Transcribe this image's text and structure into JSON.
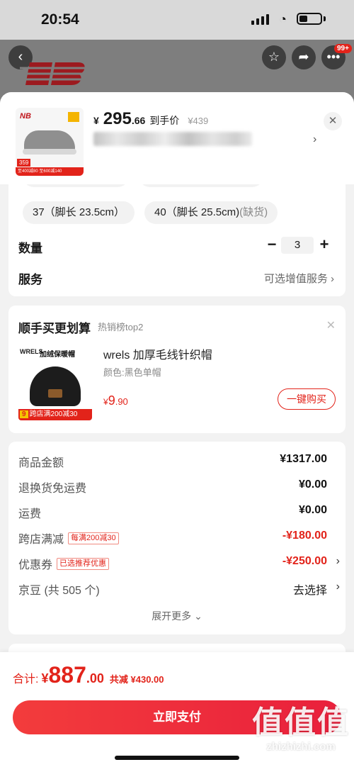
{
  "status_bar": {
    "time": "20:54"
  },
  "nav": {
    "back_icon": "‹",
    "more_badge": "99+"
  },
  "product": {
    "thumb_logo": "NB",
    "thumb_price": "359",
    "thumb_promo": "至400减80 至600减140",
    "price_yen": "¥",
    "price_int": "295",
    "price_dec": ".66",
    "price_label": "到手价",
    "price_original": "¥439",
    "spec_arrow": "›",
    "close_icon": "✕"
  },
  "sizes": {
    "row1": [
      {
        "size": "",
        "note": ""
      },
      {
        "size": "",
        "note": ""
      }
    ],
    "row2": [
      {
        "size": "37（脚长 23.5cm）",
        "note": ""
      },
      {
        "size": "40（脚长 25.5cm)",
        "note": "(缺货)"
      }
    ]
  },
  "quantity": {
    "label": "数量",
    "minus": "−",
    "value": "3",
    "plus": "+"
  },
  "service": {
    "label": "服务",
    "value": "可选增值服务  ›"
  },
  "addon": {
    "title": "顺手买更划算",
    "subtitle": "热销榜top2",
    "close_icon": "✕",
    "thumb_brand": "WRELS",
    "thumb_title": "加绒保暖帽",
    "thumb_price": "9",
    "thumb_promo": "跨店满200减30",
    "name": "wrels 加厚毛线针织帽",
    "variant": "颜色:黑色单帽",
    "price_yen": "¥",
    "price_int": "9",
    "price_dec": ".90",
    "buy_label": "一键购买"
  },
  "summary": {
    "rows": [
      {
        "label": "商品金额",
        "tag": "",
        "value": "¥1317.00",
        "arrow": ""
      },
      {
        "label": "退换货免运费",
        "tag": "",
        "value": "¥0.00",
        "arrow": ""
      },
      {
        "label": "运费",
        "tag": "",
        "value": "¥0.00",
        "arrow": ""
      },
      {
        "label": "跨店满减",
        "tag": "每满200减30",
        "value": "-¥180.00",
        "arrow": ""
      },
      {
        "label": "优惠券",
        "tag": "已选推荐优惠",
        "value": "-¥250.00",
        "arrow": "›"
      },
      {
        "label": "京豆 (共 505 个)",
        "tag": "",
        "value": "去选择",
        "arrow": "›"
      }
    ],
    "expand_label": "展开更多 ⌄"
  },
  "footer": {
    "total_label": "合计:",
    "total_yen": "¥",
    "total_int": "887",
    "total_dec": ".00",
    "total_saving": "共减 ¥430.00",
    "pay_label": "立即支付"
  },
  "watermark": {
    "big": "值值值",
    "small": "zhizhizhi.com"
  },
  "colors": {
    "accent": "#e2231a",
    "brand": "#9c1a1f"
  }
}
